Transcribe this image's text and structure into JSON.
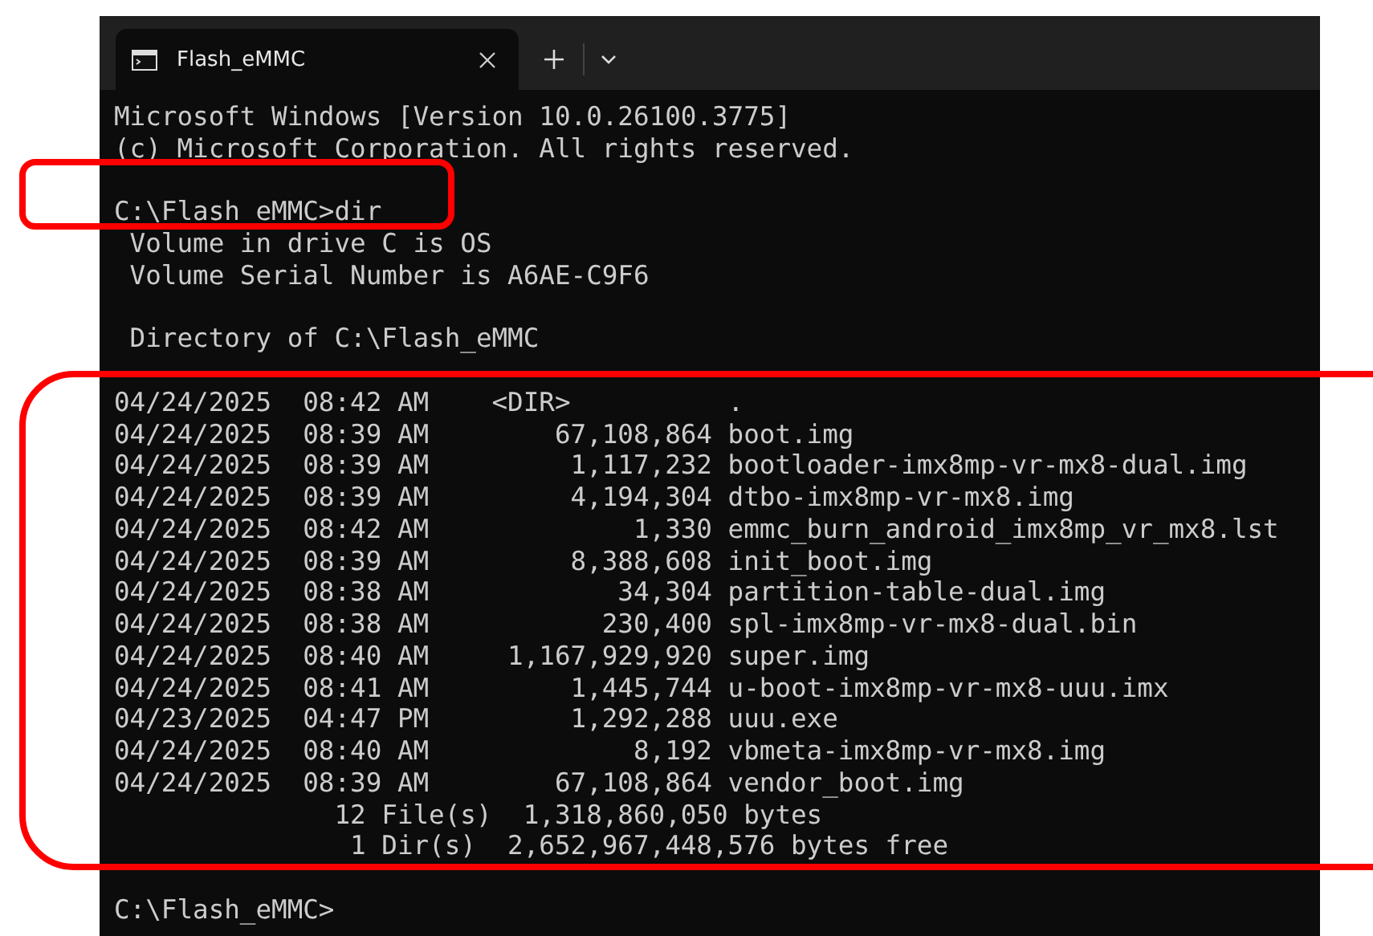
{
  "window": {
    "tabs": [
      {
        "title": "Flash_eMMC",
        "selected": true
      }
    ]
  },
  "console": {
    "lines": [
      {
        "kind": "text",
        "text": "Microsoft Windows [Version 10.0.26100.3775]"
      },
      {
        "kind": "text",
        "text": "(c) Microsoft Corporation. All rights reserved."
      },
      {
        "kind": "blank"
      },
      {
        "kind": "text",
        "text": "C:\\Flash_eMMC>dir"
      },
      {
        "kind": "text",
        "text": " Volume in drive C is OS"
      },
      {
        "kind": "text",
        "text": " Volume Serial Number is A6AE-C9F6"
      },
      {
        "kind": "blank"
      },
      {
        "kind": "text",
        "text": " Directory of C:\\Flash_eMMC"
      },
      {
        "kind": "blank"
      },
      {
        "kind": "text",
        "text": "04/24/2025  08:42 AM    <DIR>          ."
      },
      {
        "kind": "text",
        "text": "04/24/2025  08:39 AM        67,108,864 boot.img"
      },
      {
        "kind": "text",
        "text": "04/24/2025  08:39 AM         1,117,232 bootloader-imx8mp-vr-mx8-dual.img"
      },
      {
        "kind": "text",
        "text": "04/24/2025  08:39 AM         4,194,304 dtbo-imx8mp-vr-mx8.img"
      },
      {
        "kind": "text",
        "text": "04/24/2025  08:42 AM             1,330 emmc_burn_android_imx8mp_vr_mx8.lst"
      },
      {
        "kind": "text",
        "text": "04/24/2025  08:39 AM         8,388,608 init_boot.img"
      },
      {
        "kind": "text",
        "text": "04/24/2025  08:38 AM            34,304 partition-table-dual.img"
      },
      {
        "kind": "text",
        "text": "04/24/2025  08:38 AM           230,400 spl-imx8mp-vr-mx8-dual.bin"
      },
      {
        "kind": "text",
        "text": "04/24/2025  08:40 AM     1,167,929,920 super.img"
      },
      {
        "kind": "text",
        "text": "04/24/2025  08:41 AM         1,445,744 u-boot-imx8mp-vr-mx8-uuu.imx"
      },
      {
        "kind": "text",
        "text": "04/23/2025  04:47 PM         1,292,288 uuu.exe"
      },
      {
        "kind": "text",
        "text": "04/24/2025  08:40 AM             8,192 vbmeta-imx8mp-vr-mx8.img"
      },
      {
        "kind": "text",
        "text": "04/24/2025  08:39 AM        67,108,864 vendor_boot.img"
      },
      {
        "kind": "text",
        "text": "              12 File(s)  1,318,860,050 bytes"
      },
      {
        "kind": "text",
        "text": "               1 Dir(s)  2,652,967,448,576 bytes free"
      },
      {
        "kind": "blank"
      },
      {
        "kind": "text",
        "text": "C:\\Flash_eMMC>"
      }
    ]
  }
}
